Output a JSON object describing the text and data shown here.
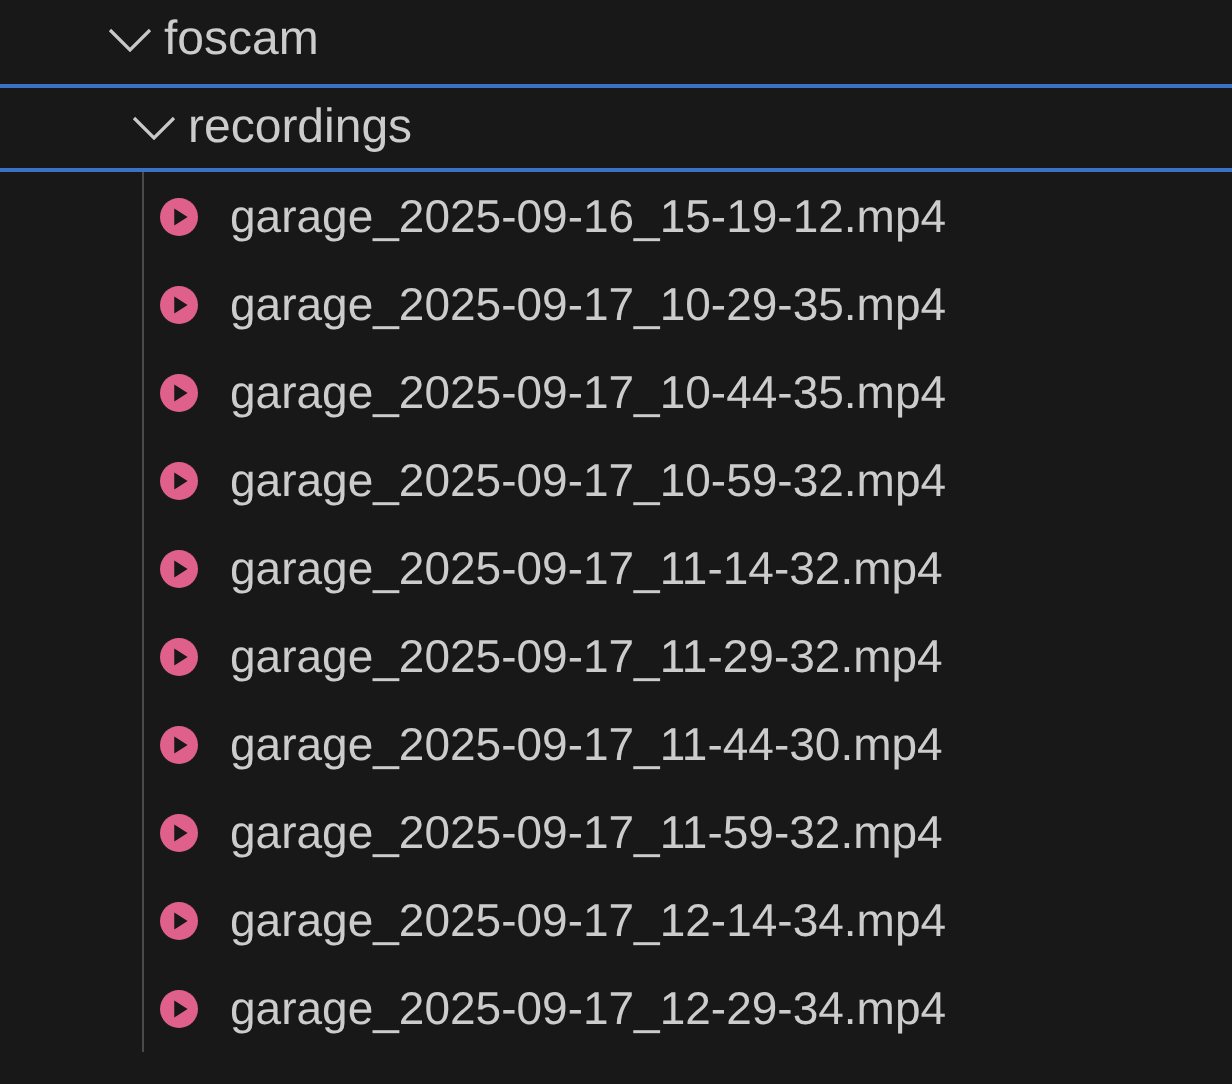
{
  "tree": [
    {
      "kind": "folder",
      "name": "foscam",
      "expanded": true,
      "selected": false,
      "children": [
        {
          "kind": "folder",
          "name": "recordings",
          "expanded": true,
          "selected": true,
          "children": [
            {
              "kind": "video",
              "name": "garage_2025-09-16_15-19-12.mp4",
              "selected": false
            },
            {
              "kind": "video",
              "name": "garage_2025-09-17_10-29-35.mp4",
              "selected": false
            },
            {
              "kind": "video",
              "name": "garage_2025-09-17_10-44-35.mp4",
              "selected": false
            },
            {
              "kind": "video",
              "name": "garage_2025-09-17_10-59-32.mp4",
              "selected": false
            },
            {
              "kind": "video",
              "name": "garage_2025-09-17_11-14-32.mp4",
              "selected": false
            },
            {
              "kind": "video",
              "name": "garage_2025-09-17_11-29-32.mp4",
              "selected": false
            },
            {
              "kind": "video",
              "name": "garage_2025-09-17_11-44-30.mp4",
              "selected": false
            },
            {
              "kind": "video",
              "name": "garage_2025-09-17_11-59-32.mp4",
              "selected": false
            },
            {
              "kind": "video",
              "name": "garage_2025-09-17_12-14-34.mp4",
              "selected": false
            },
            {
              "kind": "video",
              "name": "garage_2025-09-17_12-29-34.mp4",
              "selected": false
            }
          ]
        }
      ]
    }
  ]
}
